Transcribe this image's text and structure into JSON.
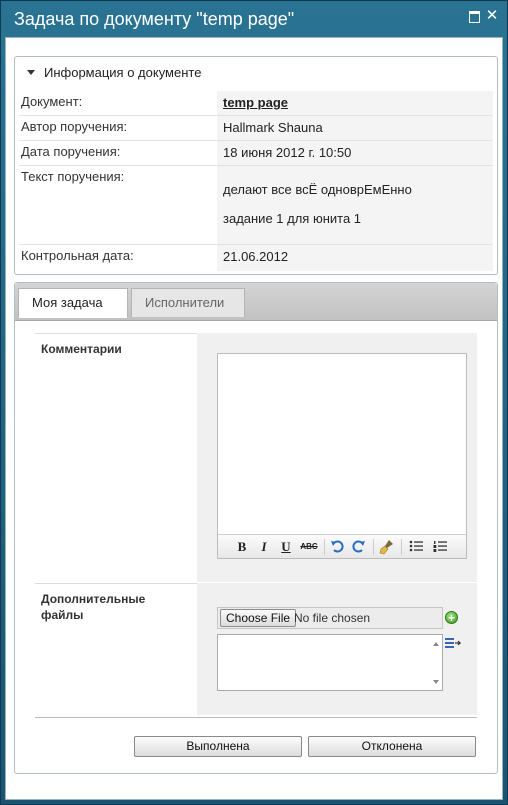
{
  "window": {
    "title": "Задача по документу \"temp page\"",
    "maximize_icon": "maximize-icon",
    "close_glyph": "✕"
  },
  "info": {
    "header": "Информация о документе",
    "rows": {
      "document": {
        "label": "Документ:",
        "value": "temp page"
      },
      "author": {
        "label": "Автор поручения:",
        "value": "Hallmark Shauna"
      },
      "date": {
        "label": "Дата поручения:",
        "value": "18 июня 2012 г. 10:50"
      },
      "text": {
        "label": "Текст поручения:",
        "line1": "делают все всЁ одноврЕмЕнно",
        "line2": "задание 1 для юнита 1"
      },
      "due": {
        "label": "Контрольная дата:",
        "value": "21.06.2012"
      }
    }
  },
  "tabs": [
    {
      "label": "Моя задача",
      "active": true
    },
    {
      "label": "Исполнители",
      "active": false
    }
  ],
  "form": {
    "comments_label": "Комментарии",
    "comments_value": "",
    "toolbar": {
      "bold": "B",
      "italic": "I",
      "underline": "U",
      "strike": "ABC",
      "icons": [
        "bold-icon",
        "italic-icon",
        "underline-icon",
        "strikethrough-icon",
        "undo-icon",
        "redo-icon",
        "clear-format-icon",
        "bulleted-list-icon",
        "numbered-list-icon"
      ]
    },
    "files_label_line1": "Дополнительные",
    "files_label_line2": "файлы",
    "choose_file": "Choose File",
    "no_file": "No file chosen",
    "add_glyph": "+"
  },
  "actions": {
    "complete": "Выполнена",
    "reject": "Отклонена"
  },
  "colors": {
    "titlebar": "#2a7393",
    "panel_bg": "#f4f4f4"
  }
}
